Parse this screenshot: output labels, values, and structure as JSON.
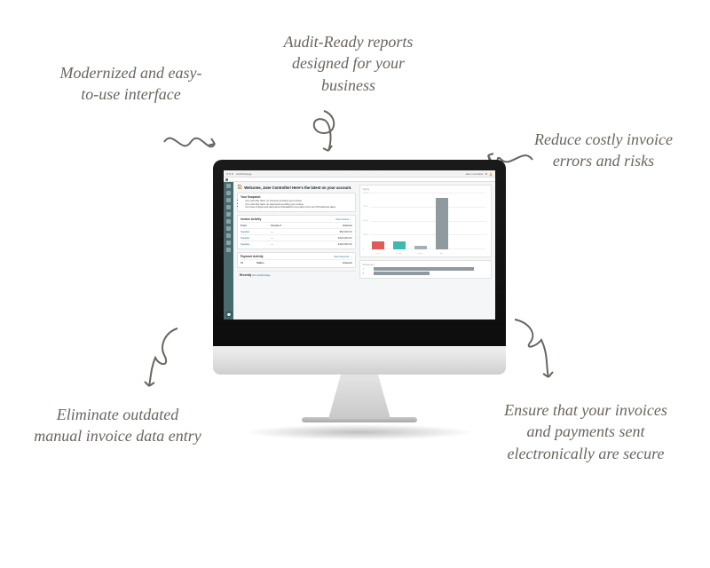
{
  "callouts": {
    "top_left": "Modernized and easy-to-use interface",
    "top_center": "Audit-Ready reports designed for your business",
    "right": "Reduce costly invoice errors and risks",
    "bottom_left": "Eliminate outdated manual invoice data entry",
    "bottom_right": "Ensure that your invoices and payments sent electronically are secure"
  },
  "browser": {
    "user_label": "Jane Controller"
  },
  "dashboard": {
    "welcome": "Welcome, Jane Controller! Here's the latest on your account.",
    "snapshot_title": "Your Snapshot",
    "bullets": [
      "You currently have no invoices pending your review.",
      "You currently have no payments pending your review.",
      "You have 0 approved payments scheduled to be paid in the next 30 business days."
    ],
    "activity": {
      "title": "Invoice Activity",
      "view_label": "View Invoices →",
      "headers": [
        "From",
        "Invoice #",
        "Amount"
      ],
      "rows": [
        [
          "Supplier",
          "—",
          "$50,000.00"
        ],
        [
          "Supplier",
          "—",
          "$100,000.00"
        ],
        [
          "Supplier",
          "—",
          "$100,000.00"
        ]
      ]
    },
    "payment": {
      "title": "Payment Activity",
      "view_label": "View Payments →",
      "headers": [
        "To",
        "Status",
        "Amount"
      ]
    },
    "feed": {
      "title": "Recently",
      "subtitle": "from AvidXchange"
    }
  },
  "chart_data": [
    {
      "type": "bar",
      "title": "Aging",
      "categories": [
        "1-30",
        "31-60",
        "61-90",
        "90+"
      ],
      "values": [
        15000,
        15000,
        7000,
        100000
      ],
      "ylim": [
        0,
        110000
      ],
      "yticks": [
        0,
        25000,
        50000,
        75000,
        100000
      ],
      "colors": [
        "#e05a5a",
        "#3fb8af",
        "#a7b0b5",
        "#8e9aa0"
      ]
    },
    {
      "type": "bar",
      "orientation": "horizontal",
      "title": "Expenses",
      "categories": [
        "A",
        "B"
      ],
      "values": [
        80,
        45
      ],
      "xlim": [
        0,
        100
      ]
    }
  ]
}
